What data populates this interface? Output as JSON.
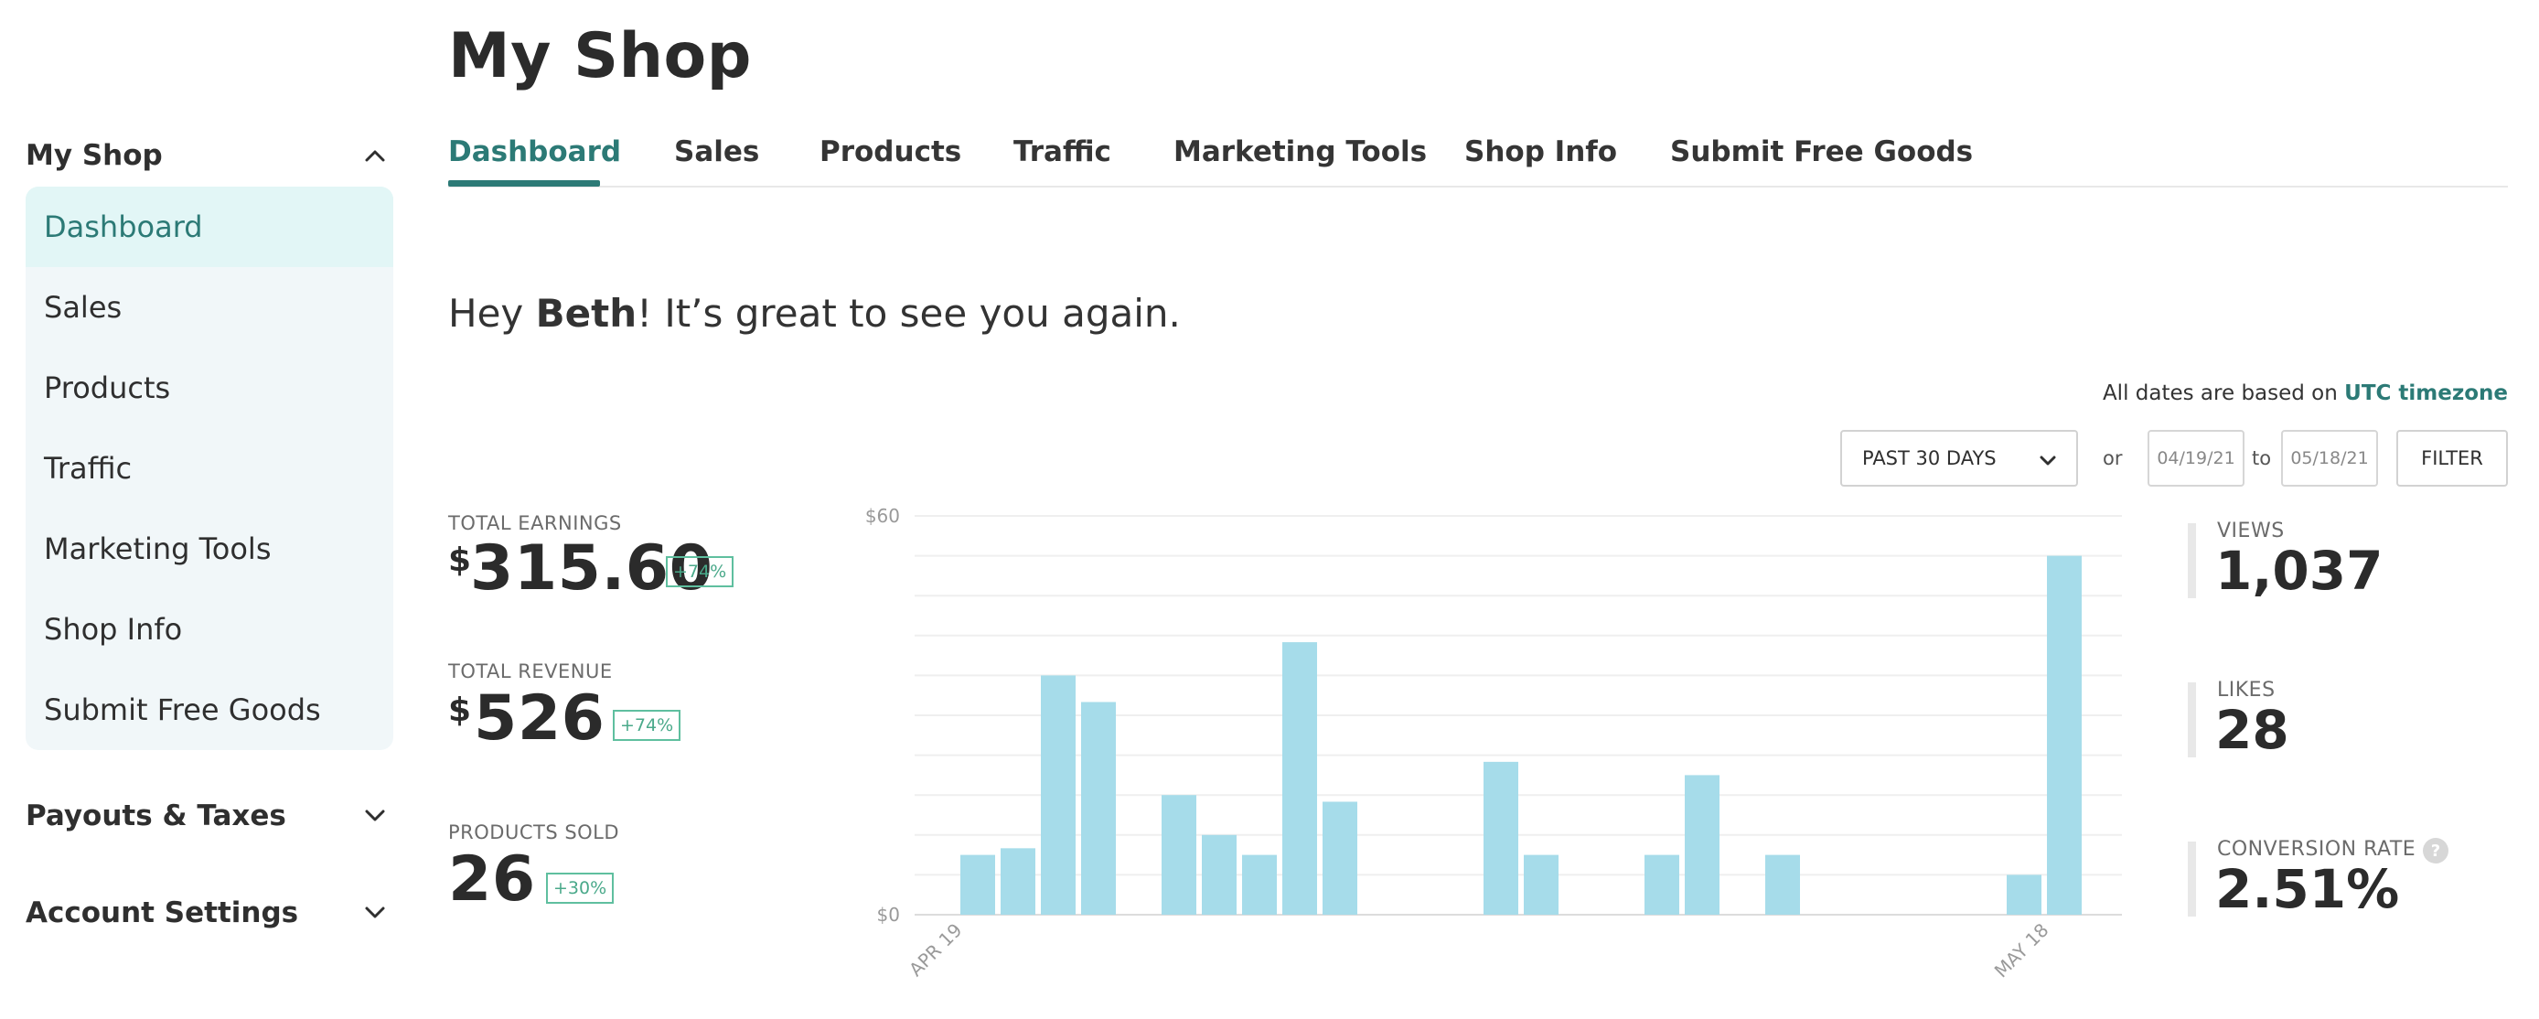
{
  "page_title": "My Shop",
  "sidebar": {
    "section_title": "My Shop",
    "items": [
      {
        "label": "Dashboard",
        "active": true
      },
      {
        "label": "Sales"
      },
      {
        "label": "Products"
      },
      {
        "label": "Traffic"
      },
      {
        "label": "Marketing Tools"
      },
      {
        "label": "Shop Info"
      },
      {
        "label": "Submit Free Goods"
      }
    ],
    "collapsed_sections": [
      {
        "label": "Payouts & Taxes"
      },
      {
        "label": "Account Settings"
      }
    ]
  },
  "tabs": [
    {
      "label": "Dashboard",
      "active": true
    },
    {
      "label": "Sales"
    },
    {
      "label": "Products"
    },
    {
      "label": "Traffic"
    },
    {
      "label": "Marketing Tools"
    },
    {
      "label": "Shop Info"
    },
    {
      "label": "Submit Free Goods"
    }
  ],
  "greeting": {
    "prefix": "Hey ",
    "name": "Beth",
    "suffix": "! It’s great to see you again."
  },
  "dates_note": {
    "text": "All dates are based on ",
    "link": "UTC timezone"
  },
  "filters": {
    "range_select": "PAST 30 DAYS",
    "or_label": "or",
    "start_date": "04/19/21",
    "to_label": "to",
    "end_date": "05/18/21",
    "filter_button": "FILTER"
  },
  "stats": {
    "earnings": {
      "label": "TOTAL EARNINGS",
      "currency": "$",
      "value": "315.60",
      "change": "+74%"
    },
    "revenue": {
      "label": "TOTAL REVENUE",
      "currency": "$",
      "value": "526",
      "change": "+74%"
    },
    "products_sold": {
      "label": "PRODUCTS SOLD",
      "value": "26",
      "change": "+30%"
    }
  },
  "metrics": {
    "views": {
      "label": "VIEWS",
      "value": "1,037"
    },
    "likes": {
      "label": "LIKES",
      "value": "28"
    },
    "conversion": {
      "label": "CONVERSION RATE",
      "value": "2.51%",
      "help": "?"
    }
  },
  "colors": {
    "accent": "#2c7a76",
    "bar": "#a6dcea",
    "badge": "#5fbf9f",
    "sidebar_bg": "#f1f7f9",
    "sidebar_active": "#e2f6f6"
  },
  "chart_data": {
    "type": "bar",
    "x_tick_labels": [
      "APR 19",
      "MAY 18"
    ],
    "y_tick_labels": [
      "$60",
      "$0"
    ],
    "ylim": [
      0,
      60
    ],
    "grid": true,
    "values": [
      9,
      10,
      36,
      32,
      0,
      18,
      12,
      9,
      41,
      17,
      0,
      0,
      0,
      23,
      9,
      0,
      0,
      9,
      21,
      0,
      9,
      0,
      0,
      0,
      0,
      0,
      6,
      54
    ]
  }
}
